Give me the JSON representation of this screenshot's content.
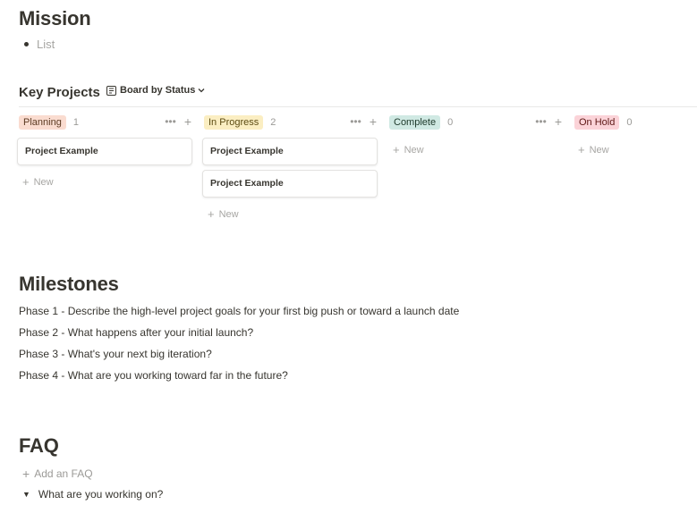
{
  "mission": {
    "title": "Mission",
    "list_placeholder": "List"
  },
  "key_projects": {
    "title": "Key Projects",
    "view_label": "Board by Status",
    "new_label": "New",
    "columns": [
      {
        "tag": "Planning",
        "count": "1",
        "tag_bg": "#fadcd0",
        "tag_color": "#5c3b23",
        "cards": [
          "Project Example"
        ]
      },
      {
        "tag": "In Progress",
        "count": "2",
        "tag_bg": "#fbeec2",
        "tag_color": "#5c4b12",
        "cards": [
          "Project Example",
          "Project Example"
        ]
      },
      {
        "tag": "Complete",
        "count": "0",
        "tag_bg": "#d0e9e3",
        "tag_color": "#1c3829",
        "cards": []
      },
      {
        "tag": "On Hold",
        "count": "0",
        "tag_bg": "#fbd3d8",
        "tag_color": "#5d1715",
        "cards": []
      }
    ]
  },
  "milestones": {
    "title": "Milestones",
    "lines": [
      "Phase 1 - Describe the high-level project goals for your first big push or toward a launch date",
      "Phase 2 - What happens after your initial launch?",
      "Phase 3 - What's your next big iteration?",
      "Phase 4 - What are you working toward far in the future?"
    ]
  },
  "faq": {
    "title": "FAQ",
    "add_label": "Add an FAQ",
    "toggle_item": "What are you working on?"
  }
}
